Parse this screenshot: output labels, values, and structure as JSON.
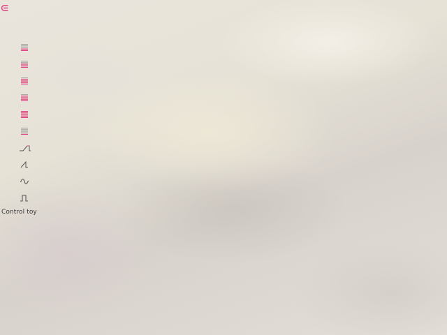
{
  "toolbar": {
    "back_icon": "back-arrow-icon"
  },
  "sidebar": {
    "items": [
      {
        "id": "level-1",
        "icon": "level-bars-icon",
        "active_bars": 2
      },
      {
        "id": "level-2",
        "icon": "level-bars-icon",
        "active_bars": 3
      },
      {
        "id": "level-3",
        "icon": "level-bars-icon",
        "active_bars": 4
      },
      {
        "id": "level-4",
        "icon": "level-bars-icon",
        "active_bars": 4
      },
      {
        "id": "level-5",
        "icon": "level-bars-icon",
        "active_bars": 5
      },
      {
        "id": "level-6",
        "icon": "level-bars-icon",
        "active_bars": 1
      },
      {
        "id": "ramp-up",
        "icon": "ramp-wave-icon"
      },
      {
        "id": "sawtooth",
        "icon": "sawtooth-wave-icon"
      },
      {
        "id": "sine",
        "icon": "sine-wave-icon"
      },
      {
        "id": "pulse",
        "icon": "pulse-wave-icon"
      }
    ]
  },
  "footer": {
    "caption": "Control toy"
  },
  "colors": {
    "accent": "#e0407f",
    "inactive": "#a8a8a8",
    "icon_dark": "#555555"
  }
}
